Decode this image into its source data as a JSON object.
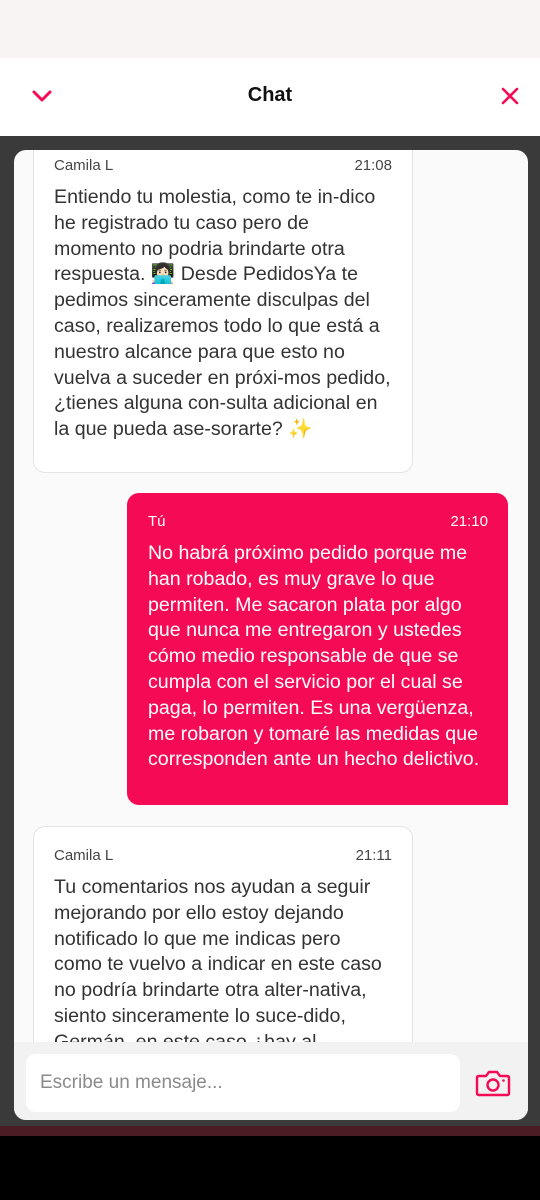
{
  "header": {
    "title": "Chat",
    "back_icon": "chevron-down-icon",
    "close_icon": "close-icon"
  },
  "messages": [
    {
      "sender": "Camila L",
      "time": "21:08",
      "direction": "incoming",
      "text": "Entiendo tu molestia, como te in-dico he registrado tu caso pero de momento no podria brindarte otra respuesta. 👩🏻‍💻 Desde PedidosYa te pedimos sinceramente disculpas del caso, realizaremos todo lo que está a nuestro alcance para que esto no vuelva a suceder en próxi-mos pedido, ¿tienes alguna con-sulta adicional en la que pueda ase-sorarte? ✨"
    },
    {
      "sender": "Tú",
      "time": "21:10",
      "direction": "outgoing",
      "text": "No habrá próximo pedido porque me han robado, es muy grave lo que permiten. Me sacaron plata por algo que nunca me entregaron y ustedes cómo medio responsable de que se cumpla con el servicio por el cual se paga, lo permiten. Es una vergüenza, me robaron y tomaré las medidas que corresponden ante un hecho delictivo."
    },
    {
      "sender": "Camila L",
      "time": "21:11",
      "direction": "incoming",
      "text": "Tu comentarios nos ayudan a seguir mejorando por ello estoy dejando notificado lo que me indicas pero como te vuelvo a indicar en este caso no podría brindarte otra alter-nativa, siento sinceramente lo suce-dido, Germán, en este caso ¿hay al-"
    }
  ],
  "composer": {
    "placeholder": "Escribe un mensaje...",
    "camera_icon": "camera-icon"
  },
  "colors": {
    "brand": "#f50a55",
    "incoming_bg": "#ffffff",
    "chat_bg": "#fafafa",
    "frame_bg": "#3a3a3a"
  }
}
